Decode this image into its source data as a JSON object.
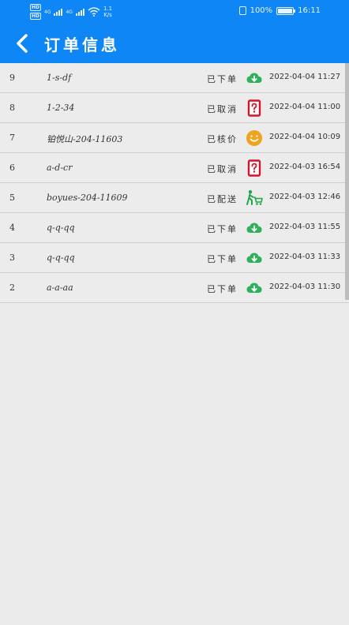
{
  "status_bar": {
    "net1": "4G",
    "net2": "4G",
    "speed_value": "1.1",
    "speed_unit": "K/s",
    "battery": "100%",
    "time": "16:11"
  },
  "header": {
    "title": "订单信息"
  },
  "orders": [
    {
      "num": "9",
      "name": "1-s-df",
      "status": "已下单",
      "icon": "cloud-download-icon",
      "time": "2022-04-04 11:27"
    },
    {
      "num": "8",
      "name": "1-2-34",
      "status": "已取消",
      "icon": "question-card-icon",
      "time": "2022-04-04 11:00"
    },
    {
      "num": "7",
      "name": "铂悦山-204-11603",
      "status": "已核价",
      "icon": "smiley-icon",
      "time": "2022-04-04 10:09"
    },
    {
      "num": "6",
      "name": "a-d-cr",
      "status": "已取消",
      "icon": "question-card-icon",
      "time": "2022-04-03 16:54"
    },
    {
      "num": "5",
      "name": "boyues-204-11609",
      "status": "已配送",
      "icon": "delivery-cart-icon",
      "time": "2022-04-03 12:46"
    },
    {
      "num": "4",
      "name": "q-q-qq",
      "status": "已下单",
      "icon": "cloud-download-icon",
      "time": "2022-04-03 11:55"
    },
    {
      "num": "3",
      "name": "q-q-qq",
      "status": "已下单",
      "icon": "cloud-download-icon",
      "time": "2022-04-03 11:33"
    },
    {
      "num": "2",
      "name": "a-a-aa",
      "status": "已下单",
      "icon": "cloud-download-icon",
      "time": "2022-04-03 11:30"
    }
  ],
  "colors": {
    "header_bg": "#0f86f5",
    "cloud_green": "#2eb15a",
    "question_red": "#d2152b",
    "smiley_orange": "#f0a31c",
    "cart_green": "#22a64a"
  }
}
